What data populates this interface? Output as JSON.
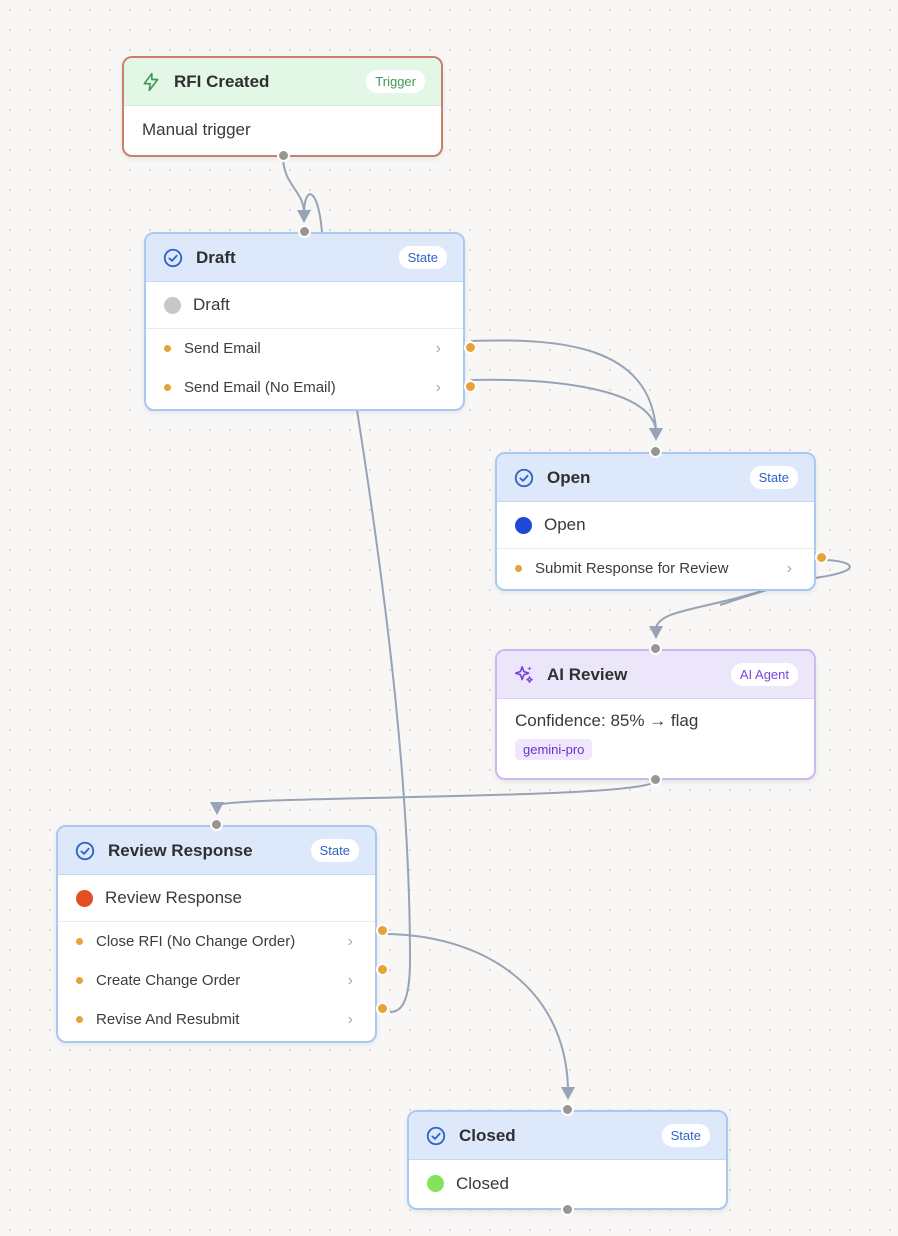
{
  "nodes": {
    "rfi_created": {
      "title": "RFI Created",
      "badge": "Trigger",
      "icon": "lightning-icon",
      "body": "Manual trigger",
      "accent": "#3f9a52"
    },
    "draft": {
      "title": "Draft",
      "badge": "State",
      "icon": "check-circle-icon",
      "status": "Draft",
      "status_color": "#c8c8c8",
      "actions": [
        {
          "label": "Send Email"
        },
        {
          "label": "Send Email (No Email)"
        }
      ]
    },
    "open": {
      "title": "Open",
      "badge": "State",
      "icon": "check-circle-icon",
      "status": "Open",
      "status_color": "#1f48d6",
      "actions": [
        {
          "label": "Submit Response for Review"
        }
      ]
    },
    "ai_review": {
      "title": "AI Review",
      "badge": "AI Agent",
      "icon": "sparkles-icon",
      "body": "Confidence: 85% → flag",
      "model": "gemini-pro",
      "accent": "#7b44dd"
    },
    "review_response": {
      "title": "Review Response",
      "badge": "State",
      "icon": "check-circle-icon",
      "status": "Review Response",
      "status_color": "#e14f23",
      "actions": [
        {
          "label": "Close RFI (No Change Order)"
        },
        {
          "label": "Create Change Order"
        },
        {
          "label": "Revise And Resubmit"
        }
      ]
    },
    "closed": {
      "title": "Closed",
      "badge": "State",
      "icon": "check-circle-icon",
      "status": "Closed",
      "status_color": "#83e35a"
    }
  },
  "colors": {
    "state_border": "#a9c9f3",
    "edge": "#97a3b6",
    "action_handle": "#e9a13a",
    "node_handle": "#9a9591"
  }
}
